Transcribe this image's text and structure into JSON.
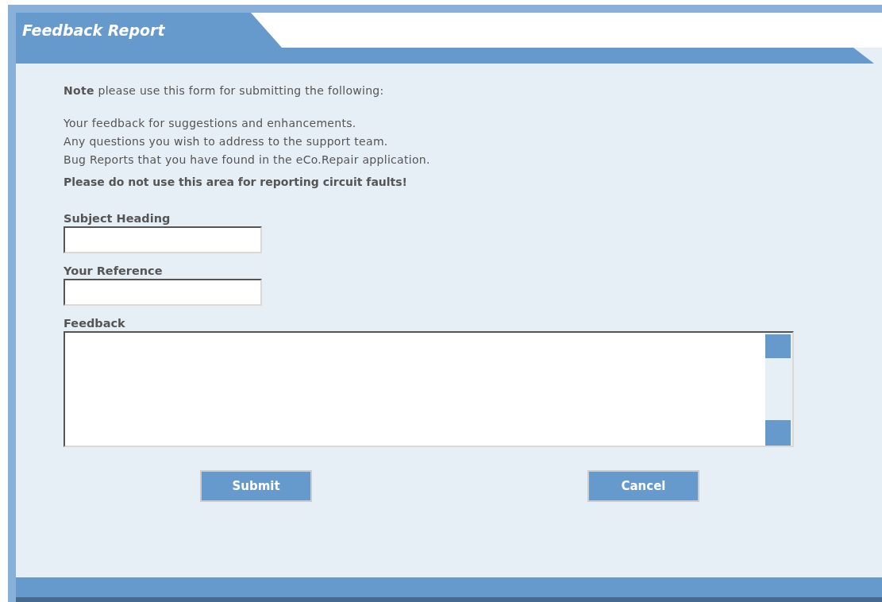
{
  "window": {
    "title": "Feedback Report"
  },
  "intro": "**Note** please use this form for submitting the following:",
  "items": [
    "Your feedback for suggestions and enhancements.",
    "Any questions you wish to address to the support team.",
    "Bug Reports that you have found in the eCo.Repair application."
  ],
  "warning": "Please do not use this area for reporting circuit faults!",
  "fields": [
    {
      "label": "Subject Heading"
    },
    {
      "label": "Your Reference"
    }
  ],
  "feedback": {
    "label": "Feedback"
  },
  "buttons": [
    {
      "label": "Submit"
    },
    {
      "label": "Cancel"
    }
  ]
}
